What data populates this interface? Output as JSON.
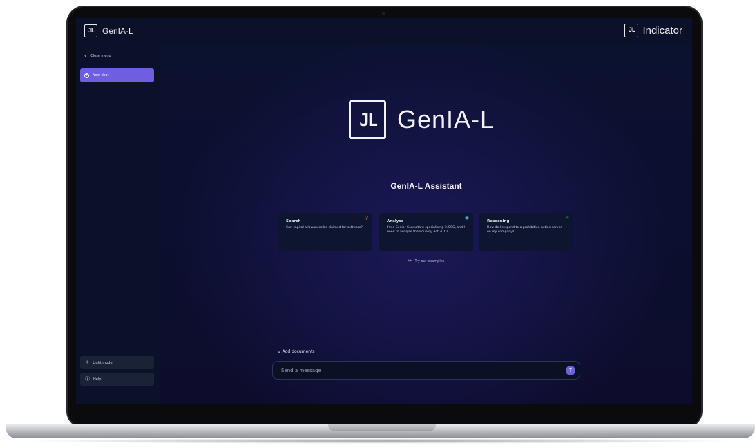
{
  "app": {
    "brand_small": "GenIA-L",
    "logo_mark": "JL",
    "partner": "Indicator"
  },
  "sidebar": {
    "close_menu": "Close menu",
    "new_chat": "New chat",
    "light_mode": "Light mode",
    "help": "Help"
  },
  "main": {
    "hero_title": "GenIA-L",
    "assistant_title": "GenIA-L Assistant",
    "cards": [
      {
        "title": "Search",
        "text": "Can capital allowances be claimed for software?",
        "icon": "search-icon",
        "icon_color": "#e07a3a"
      },
      {
        "title": "Analyse",
        "text": "I'm a Senior Consultant specialising in ESG, and I need to analyse the Equality Act 2010.",
        "icon": "eye-icon",
        "icon_color": "#5fa8e8"
      },
      {
        "title": "Reasoning",
        "text": "How do I respond to a prohibition notice served on my company?",
        "icon": "share-icon",
        "icon_color": "#3fc4a6"
      }
    ],
    "try_examples": "Try our examples",
    "add_documents": "Add documents",
    "message_placeholder": "Send a message"
  },
  "colors": {
    "accent": "#6f5ee0",
    "background": "#0b1230",
    "sidebar": "#0a1128"
  }
}
